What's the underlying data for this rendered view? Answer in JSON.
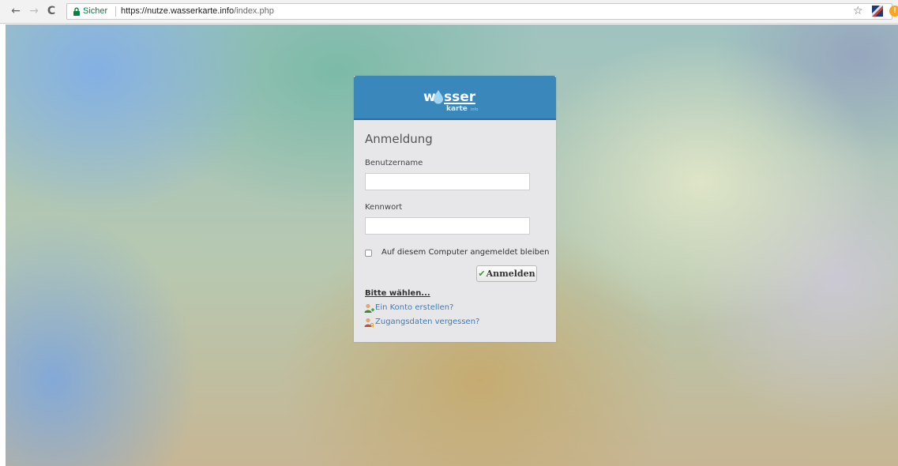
{
  "browser": {
    "secure_label": "Sicher",
    "url_host": "https://nutze.wasserkarte.info",
    "url_path": "/index.php",
    "icons": [
      "back-icon",
      "forward-icon",
      "reload-icon",
      "lock-icon",
      "star-icon",
      "extension-icon",
      "notification-icon"
    ],
    "back_glyph": "←",
    "forward_glyph": "→",
    "reload_glyph": "C",
    "star_glyph": "☆",
    "alert_glyph": "!"
  },
  "colors": {
    "header_blue": "#3a87bb",
    "card_bg": "#e7e7e9",
    "link_blue": "#3b7dbf",
    "secure_green": "#0b8043"
  },
  "logo": {
    "wordmark_left": "w",
    "wordmark_right": "sser",
    "subline": "karte",
    "suffix": "info"
  },
  "login": {
    "title": "Anmeldung",
    "username_label": "Benutzername",
    "username_value": "",
    "password_label": "Kennwort",
    "password_value": "",
    "remember_label": "Auf diesem Computer angemeldet bleiben",
    "remember_checked": false,
    "submit_icon": "✔",
    "submit_label": "Anmelden",
    "choose_label": "Bitte wählen...",
    "links": [
      {
        "label": "Ein Konto erstellen?",
        "icon": "user-add-icon"
      },
      {
        "label": "Zugangsdaten vergessen?",
        "icon": "user-key-icon"
      }
    ]
  }
}
